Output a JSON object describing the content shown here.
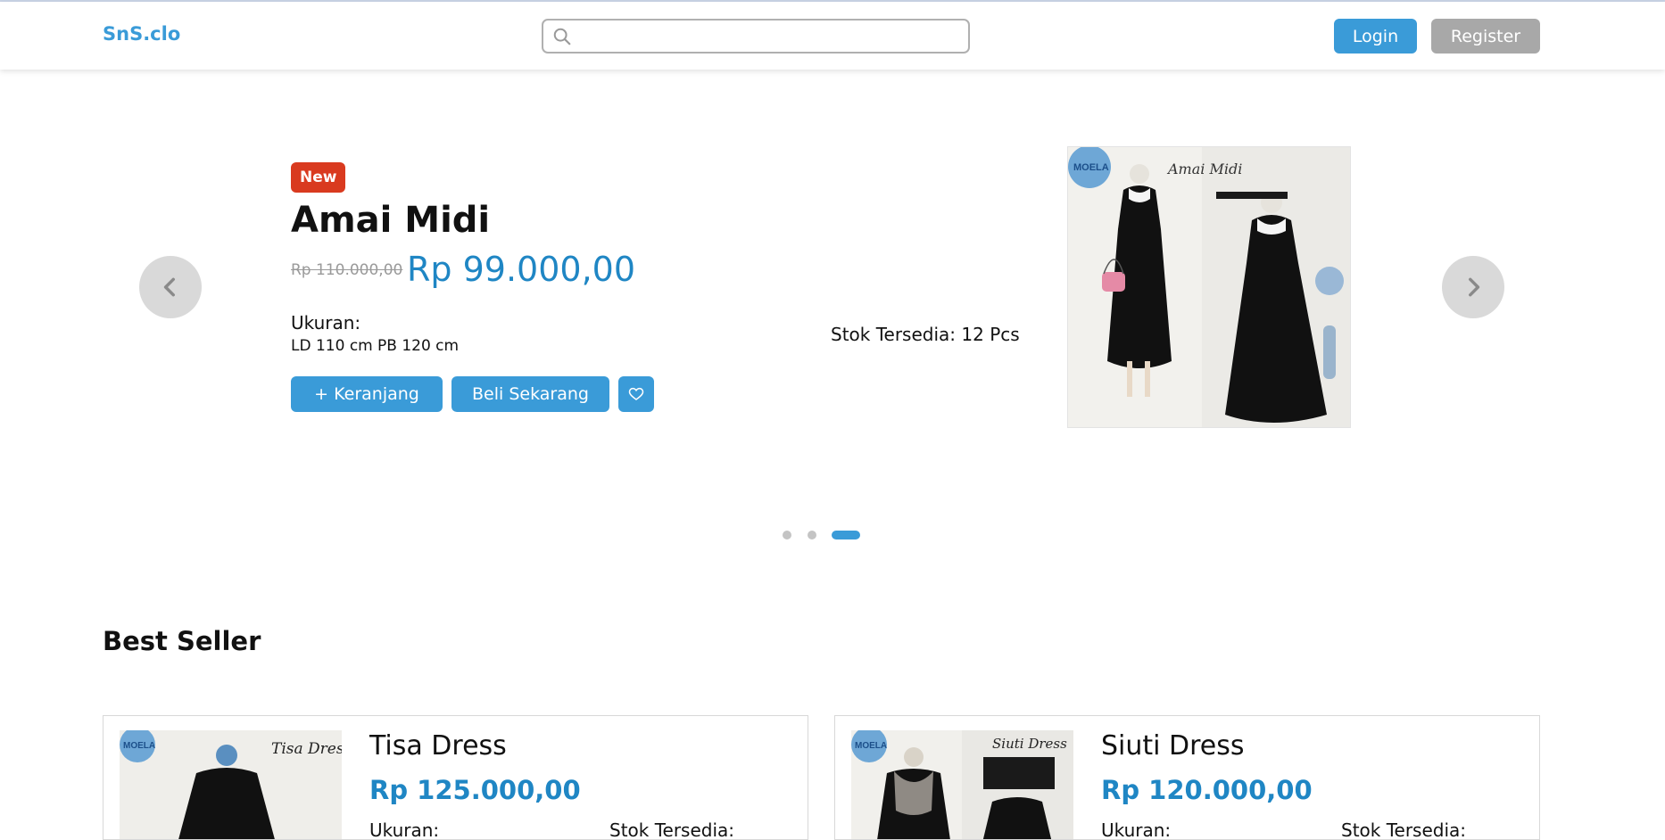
{
  "brand": "SnS.clo",
  "search": {
    "placeholder": "",
    "value": ""
  },
  "auth": {
    "login_label": "Login",
    "register_label": "Register"
  },
  "hero": {
    "badge": "New",
    "title": "Amai Midi",
    "old_price": "Rp 110.000,00",
    "price": "Rp 99.000,00",
    "size_label": "Ukuran:",
    "size_ld": "LD 110 cm",
    "size_pb": "PB 120 cm",
    "stock": "Stok Tersedia: 12 Pcs",
    "cart_label": "+ Keranjang",
    "buy_label": "Beli Sekarang",
    "image_brand": "MOELA",
    "image_script": "Amai Midi"
  },
  "carousel": {
    "total": 3,
    "active_index": 3
  },
  "best_seller": {
    "title": "Best Seller",
    "items": [
      {
        "name": "Tisa Dress",
        "price": "Rp 125.000,00",
        "size_label": "Ukuran:",
        "stock_label": "Stok Tersedia:",
        "image_brand": "MOELA",
        "image_script": "Tisa Dress"
      },
      {
        "name": "Siuti Dress",
        "price": "Rp 120.000,00",
        "size_label": "Ukuran:",
        "stock_label": "Stok Tersedia:",
        "image_brand": "MOELA",
        "image_script": "Siuti Dress"
      }
    ]
  },
  "colors": {
    "accent": "#3a9bd8",
    "price": "#1f86c4",
    "badge": "#d93a1f",
    "muted": "#a8a8a8"
  },
  "icons": [
    "search-icon",
    "chevron-left-icon",
    "chevron-right-icon",
    "heart-icon"
  ]
}
